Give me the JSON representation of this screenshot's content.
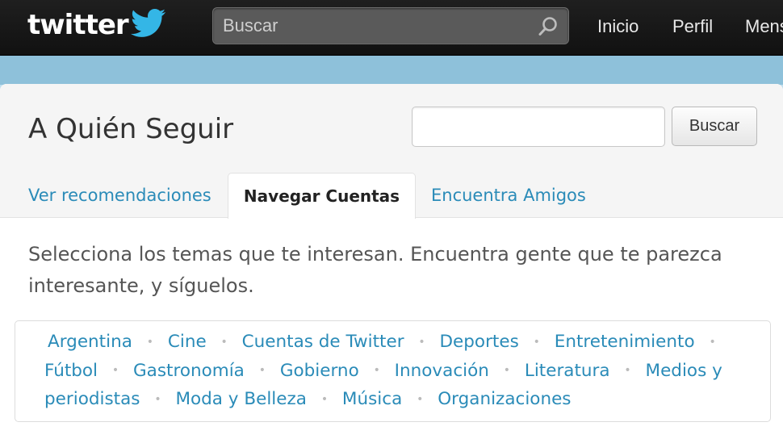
{
  "header": {
    "logo_text": "twitter",
    "search": {
      "placeholder": "Buscar"
    },
    "nav": [
      {
        "label": "Inicio"
      },
      {
        "label": "Perfil"
      },
      {
        "label": "Mensajes"
      }
    ]
  },
  "page": {
    "title": "A Quién Seguir",
    "search_button": "Buscar",
    "search_value": "",
    "tabs": [
      {
        "label": "Ver recomendaciones",
        "active": false
      },
      {
        "label": "Navegar Cuentas",
        "active": true
      },
      {
        "label": "Encuentra Amigos",
        "active": false
      }
    ],
    "intro": "Selecciona los temas que te interesan. Encuentra gente que te parezca interesante, y síguelos.",
    "topics": [
      "Argentina",
      "Cine",
      "Cuentas de Twitter",
      "Deportes",
      "Entretenimiento",
      "Fútbol",
      "Gastronomía",
      "Gobierno",
      "Innovación",
      "Literatura",
      "Medios y periodistas",
      "Moda y Belleza",
      "Música",
      "Organizaciones"
    ],
    "separator": "•"
  },
  "colors": {
    "topbar": "#141414",
    "band": "#8ec1da",
    "link": "#2a8bb8",
    "logo_bird": "#33b5e5"
  }
}
